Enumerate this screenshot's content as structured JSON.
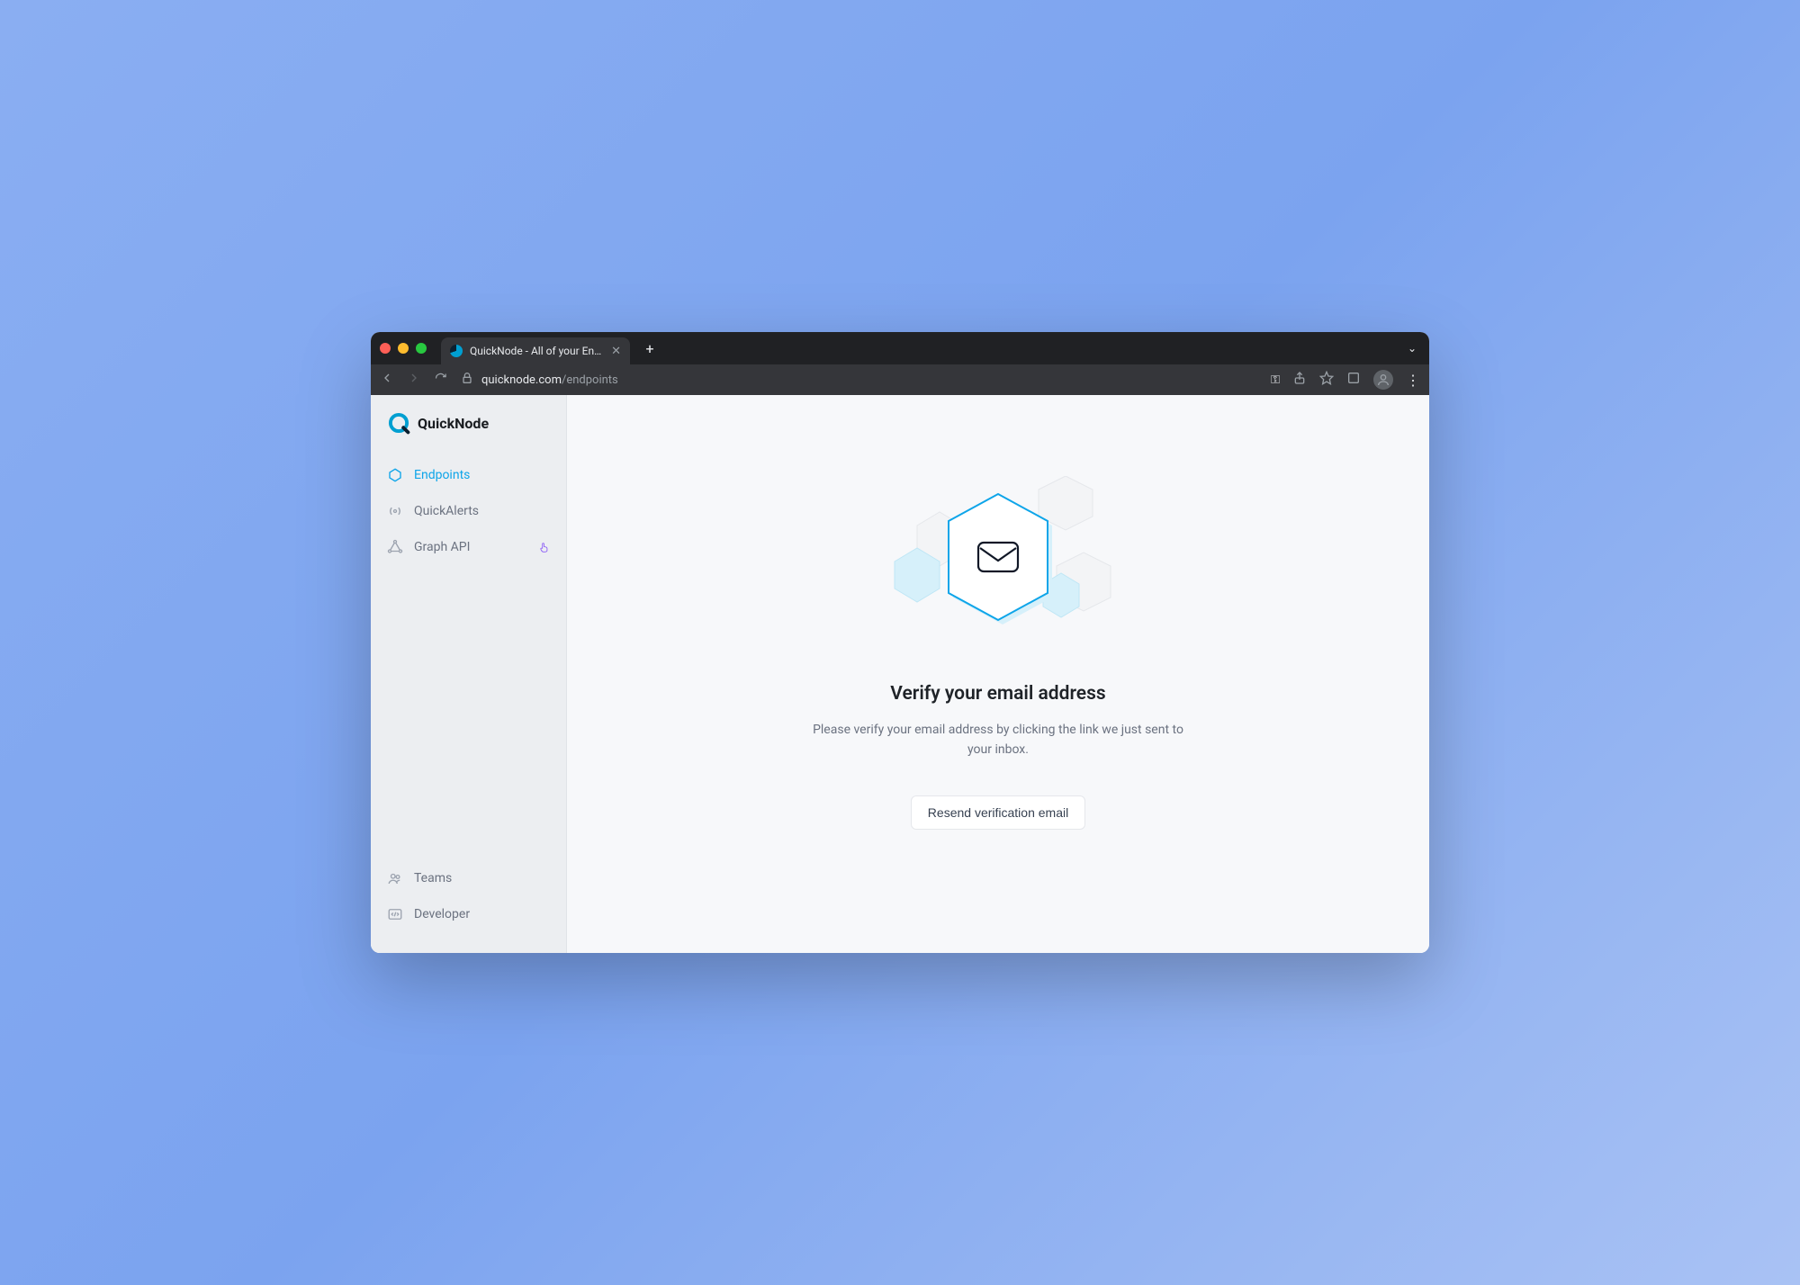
{
  "browser": {
    "tab_title": "QuickNode - All of your Endpoi",
    "url_domain": "quicknode.com",
    "url_path": "/endpoints"
  },
  "brand": {
    "name": "QuickNode"
  },
  "sidebar": {
    "items": [
      {
        "label": "Endpoints",
        "icon": "hexagon-icon",
        "active": true
      },
      {
        "label": "QuickAlerts",
        "icon": "broadcast-icon",
        "active": false
      },
      {
        "label": "Graph API",
        "icon": "graph-icon",
        "active": false,
        "badge": "pointer-icon"
      }
    ],
    "footer_items": [
      {
        "label": "Teams",
        "icon": "teams-icon"
      },
      {
        "label": "Developer",
        "icon": "code-icon"
      }
    ]
  },
  "main": {
    "headline": "Verify your email address",
    "subtext": "Please verify your email address by clicking the link we just sent to your inbox.",
    "button_label": "Resend verification email"
  }
}
